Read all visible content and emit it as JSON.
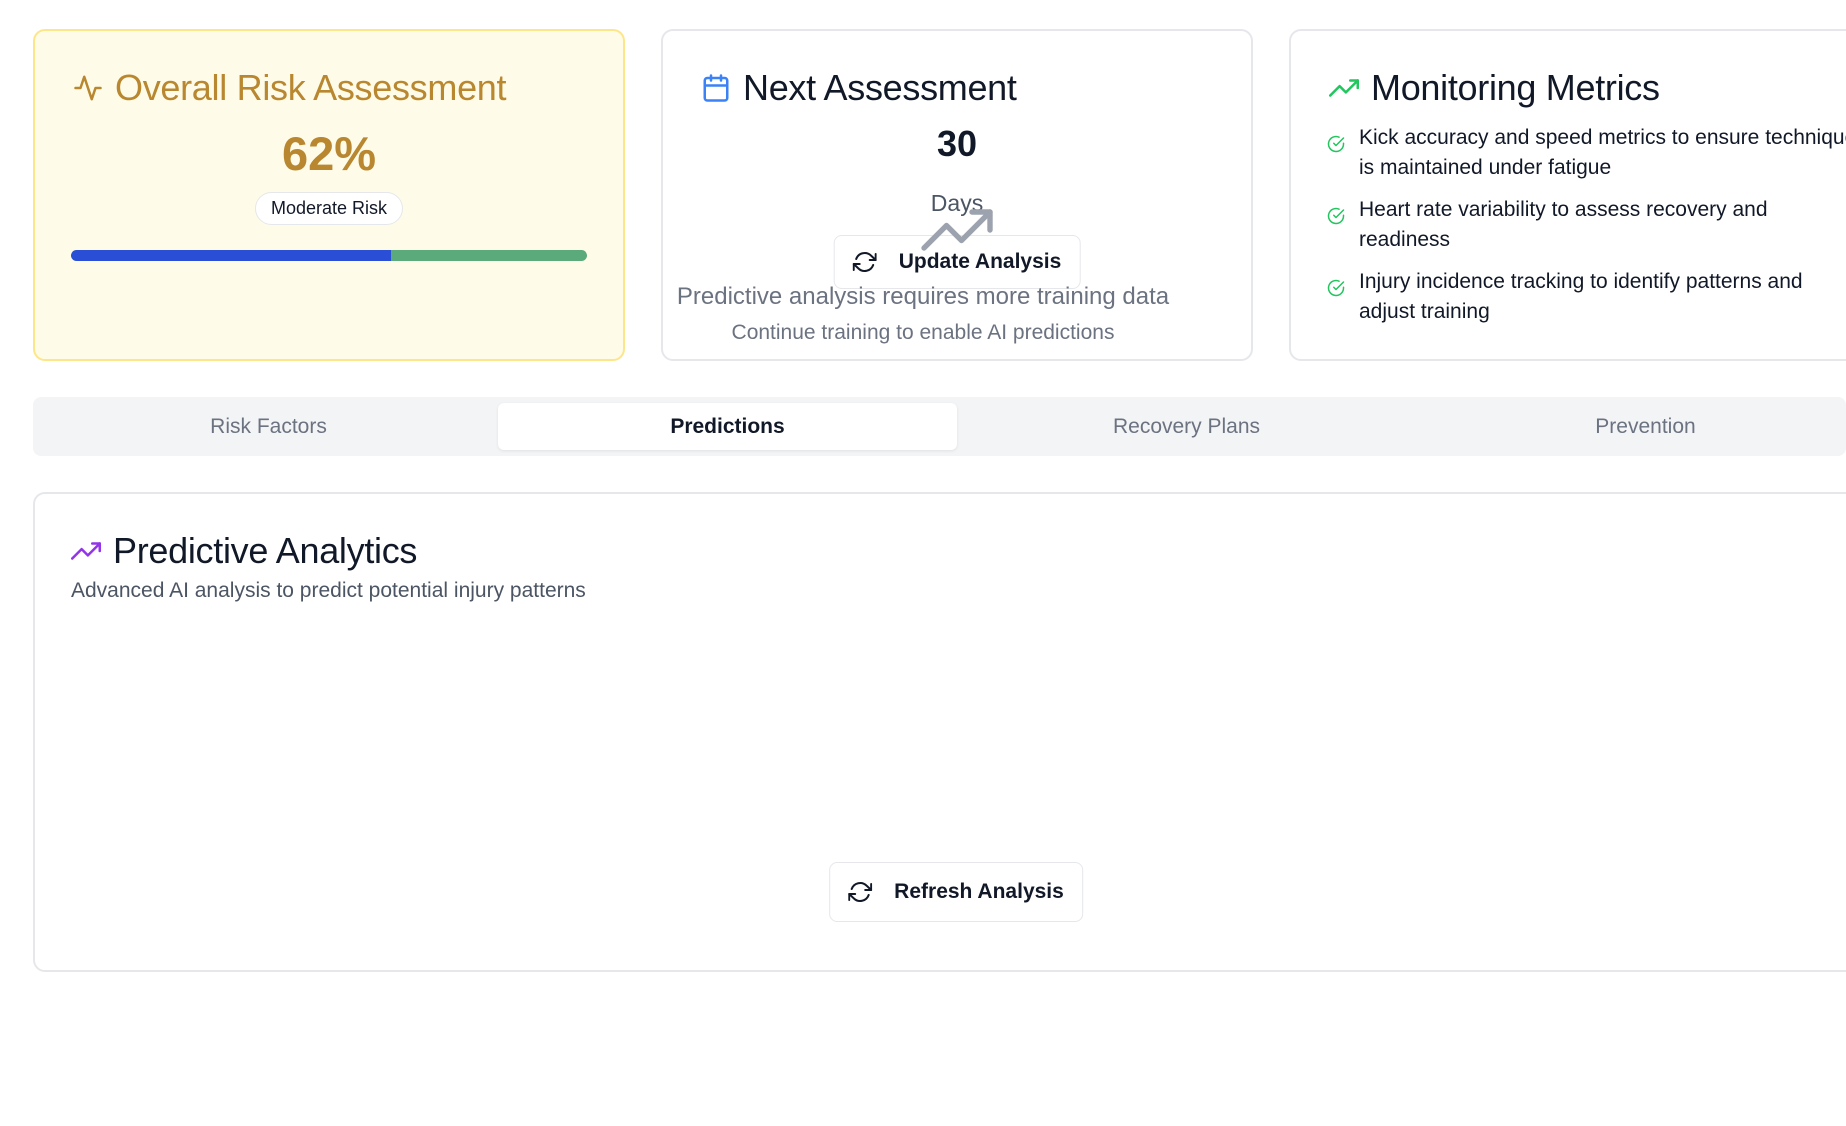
{
  "cards": {
    "risk": {
      "title": "Overall Risk Assessment",
      "value": "62%",
      "badge": "Moderate Risk",
      "progress_fraction": 0.62,
      "accent_color": "#b8872f",
      "icon": "activity-icon"
    },
    "next": {
      "title": "Next Assessment",
      "value": "30",
      "unit": "Days",
      "button": "Update Analysis",
      "icon": "calendar-icon"
    },
    "metrics": {
      "title": "Monitoring Metrics",
      "icon": "trending-up-icon",
      "items": [
        "Kick accuracy and speed metrics to ensure technique is maintained under fatigue",
        "Heart rate variability to assess recovery and readiness",
        "Injury incidence tracking to identify patterns and adjust training"
      ]
    }
  },
  "tabs": [
    {
      "label": "Risk Factors",
      "active": false
    },
    {
      "label": "Predictions",
      "active": true
    },
    {
      "label": "Recovery Plans",
      "active": false
    },
    {
      "label": "Prevention",
      "active": false
    }
  ],
  "predictive": {
    "title": "Predictive Analytics",
    "subtitle": "Advanced AI analysis to predict potential injury patterns",
    "empty_title": "Predictive analysis requires more training data",
    "empty_subtitle": "Continue training to enable AI predictions",
    "button": "Refresh Analysis",
    "icon": "trending-up-icon",
    "icon_color": "#9333ea"
  },
  "colors": {
    "progress_primary": "#2a4fd6",
    "progress_track": "#5aaa7c",
    "calendar_icon": "#3b82f6",
    "metrics_icon": "#22c55e"
  }
}
